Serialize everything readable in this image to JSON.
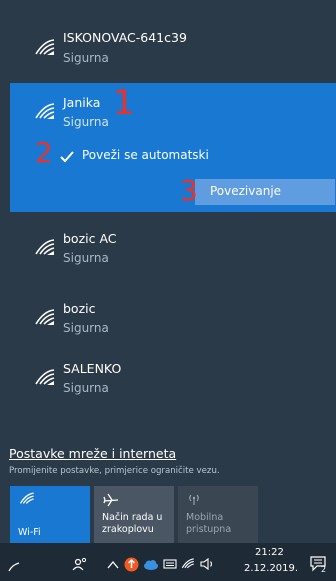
{
  "networks": [
    {
      "ssid": "ISKONOVAC-641c39",
      "status": "Sigurna"
    },
    {
      "ssid": "Janika",
      "status": "Sigurna"
    },
    {
      "ssid": "bozic AC",
      "status": "Sigurna"
    },
    {
      "ssid": "bozic",
      "status": "Sigurna"
    },
    {
      "ssid": "SALENKO",
      "status": "Sigurna"
    }
  ],
  "selected": {
    "auto_connect_label": "Poveži se automatski",
    "auto_connect_checked": true,
    "connect_button_label": "Povezivanje"
  },
  "annotations": [
    "1",
    "2",
    "3"
  ],
  "settings": {
    "link_label": "Postavke mreže i interneta",
    "description": "Promijenite postavke, primjerice ograničite vezu."
  },
  "quick_actions": [
    {
      "label": "Wi-Fi",
      "icon": "wifi-icon",
      "state": "on"
    },
    {
      "label": "Način rada u zrakoplovu",
      "icon": "airplane-icon",
      "state": "off"
    },
    {
      "label": "Mobilna pristupna",
      "icon": "hotspot-icon",
      "state": "disabled"
    }
  ],
  "taskbar": {
    "time": "21:22",
    "date": "2.12.2019.",
    "notification_count": "2"
  },
  "colors": {
    "panel": "#2b3a48",
    "selected": "#1878d2",
    "connect_button": "#5f9ce0",
    "annotation": "#e8322b",
    "tile_active": "#1878d2",
    "tile_inactive": "#4a5663"
  }
}
